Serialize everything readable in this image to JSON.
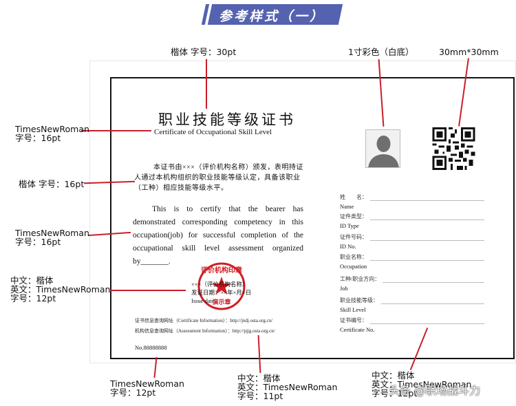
{
  "banner": {
    "title": "参考样式（一）",
    "color": "#5462b0"
  },
  "certificate": {
    "title_cn": "职业技能等级证书",
    "title_en": "Certificate of Occupational Skill Level",
    "para_cn": "本证书由×××（评价机构名称）颁发，表明持证人通过本机构组织的职业技能等级认定，具备该职业（工种）相应技能等级水平。",
    "para_en": "This is to certify that the bearer has demonstrated corresponding competency in this occupation(job) for successful completion of the occupational skill level assessment organized by_______.",
    "issuer": "×××（评价机构名称）",
    "issue_date_cn": "发证日期：××年×月×日",
    "issue_date_en": "Issue date",
    "stamp_text": "评价机构印章",
    "stamp_demo": "演示章",
    "url_cert": "证书信息查询网址（Certificate Information）：http://jndj.osta.org.cn/",
    "url_assess": "机构信息查询网址（Assessment Information）：http://pjjg.osta.org.cn/",
    "cert_no": "No.88888888",
    "fields": [
      {
        "cn": "姓　　名：",
        "en": "Name"
      },
      {
        "cn": "证件类型：",
        "en": "ID Type"
      },
      {
        "cn": "证件号码：",
        "en": "ID No."
      },
      {
        "cn": "职业名称：",
        "en": "Occupation"
      },
      {
        "cn": "工种/职业方向：",
        "en": "Job"
      },
      {
        "cn": "职业技能等级：",
        "en": "Skill Level"
      },
      {
        "cn": "证书编号：",
        "en": "Certificate No."
      }
    ]
  },
  "annotations": {
    "title_font": "楷体 字号：30pt",
    "photo": "1寸彩色（白底）",
    "qr": "30mm*30mm",
    "subtitle_font": [
      "TimesNewRoman",
      "字号：16pt"
    ],
    "para_cn_font": "楷体 字号：16pt",
    "para_en_font": [
      "TimesNewRoman",
      "字号：16pt"
    ],
    "issuer_font": [
      "中文：楷体",
      "英文：TimesNewRoman",
      "字号：12pt"
    ],
    "certno_font": [
      "TimesNewRoman",
      "字号：12pt"
    ],
    "url_font": [
      "中文：楷体",
      "英文：TimesNewRoman",
      "字号：11pt"
    ],
    "fields_font": [
      "中文：楷体",
      "英文：TimesNewRoman",
      "字号：12pt"
    ]
  },
  "watermark": "头条 @职场战斗力"
}
